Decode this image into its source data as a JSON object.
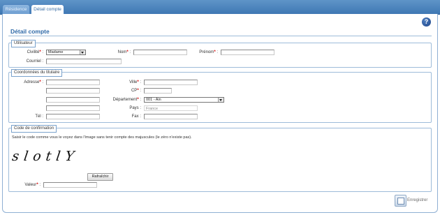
{
  "tabs": [
    {
      "label": "Résidence"
    },
    {
      "label": "Détail compte"
    }
  ],
  "help_icon": {
    "glyph": "?"
  },
  "page_title": "Détail compte",
  "utilisateur": {
    "legend": "Utilisateur",
    "civilite_label": "Civilité",
    "civilite_value": "Madame",
    "nom_label": "Nom",
    "nom_value": "",
    "prenom_label": "Prénom",
    "prenom_value": "",
    "courriel_label": "Courriel",
    "courriel_value": ""
  },
  "coordonnees": {
    "legend": "Coordonnées du titulaire",
    "adresse_label": "Adresse",
    "ville_label": "Ville",
    "cp_label": "CP",
    "departement_label": "Département",
    "departement_value": "001 - Ain",
    "pays_label": "Pays",
    "pays_value": "France",
    "tel_label": "Tél",
    "fax_label": "Fax"
  },
  "confirmation": {
    "legend": "Code de confirmation",
    "instruction": "Saisir le code comme vous le voyez dans l'image sans tenir compte des majuscules (le zéro n'existe pas).",
    "captcha_text": "slotlY",
    "refresh_label": "Rafraîchir",
    "valeur_label": "Valeur",
    "valeur_value": ""
  },
  "required_mark": "*",
  "colon": ":",
  "save_label": "Enregistrer",
  "colors": {
    "accent": "#2f6aa8",
    "required": "#d40000",
    "topbar": "#4a82bd"
  }
}
